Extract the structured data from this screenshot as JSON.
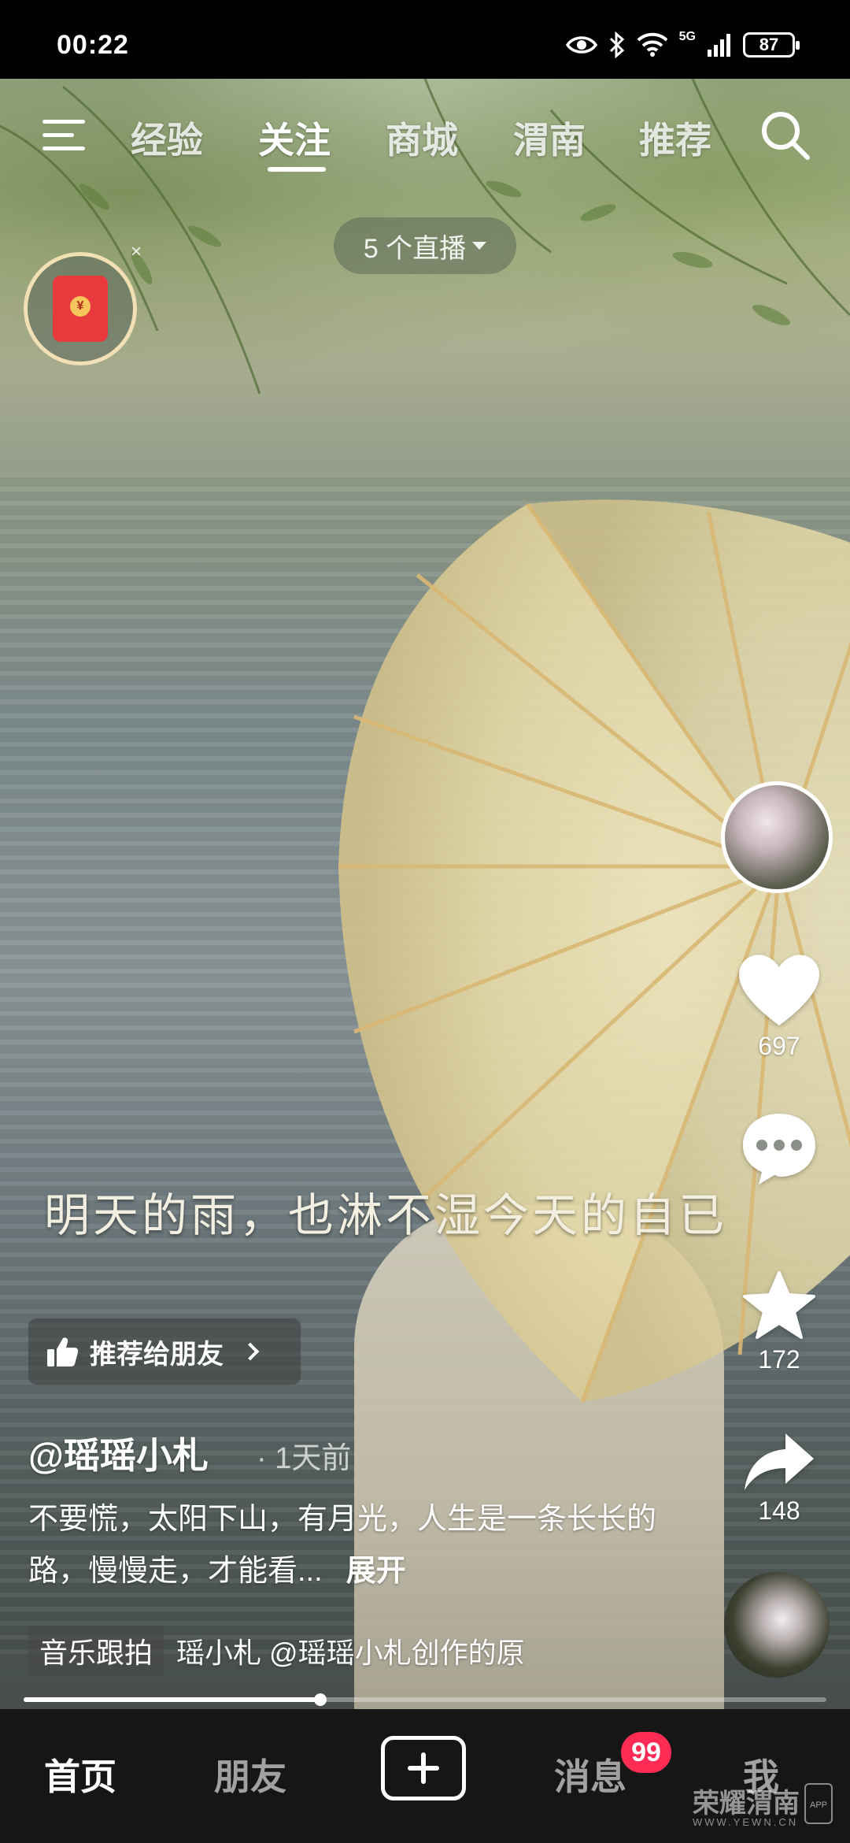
{
  "status_bar": {
    "time": "00:22",
    "network": "5G",
    "battery": "87"
  },
  "top_nav": {
    "tabs": [
      {
        "label": "经验",
        "active": false
      },
      {
        "label": "关注",
        "active": true
      },
      {
        "label": "商城",
        "active": false
      },
      {
        "label": "渭南",
        "active": false
      },
      {
        "label": "推荐",
        "active": false
      }
    ],
    "live_pill": "5 个直播"
  },
  "redpacket": {
    "symbol": "¥",
    "close": "×"
  },
  "video": {
    "subtitle": "明天的雨，也淋不湿今天的自已"
  },
  "right_rail": {
    "likes": "697",
    "favorites": "172",
    "shares": "148"
  },
  "info": {
    "recommend_label": "推荐给朋友",
    "author": "@瑶瑶小札",
    "posted": "· 1天前",
    "description": "不要慌，太阳下山，有月光，人生是一条长长的路，慢慢走，才能看...",
    "expand": "展开",
    "music_tag": "音乐跟拍",
    "music_text": "瑶小札    @瑶瑶小札创作的原"
  },
  "progress": {
    "fraction": 0.37
  },
  "bottom_nav": {
    "items": [
      {
        "label": "首页",
        "active": true
      },
      {
        "label": "朋友",
        "active": false
      },
      {
        "label": "消息",
        "active": false
      },
      {
        "label": "我",
        "active": false
      }
    ],
    "message_badge": "99"
  },
  "watermark": {
    "title": "荣耀渭南",
    "sub": "WWW.YEWN.CN",
    "app": "APP"
  },
  "colors": {
    "badge": "#fe2c55",
    "nav_bg": "#161616",
    "redpacket": "#e8393d"
  }
}
